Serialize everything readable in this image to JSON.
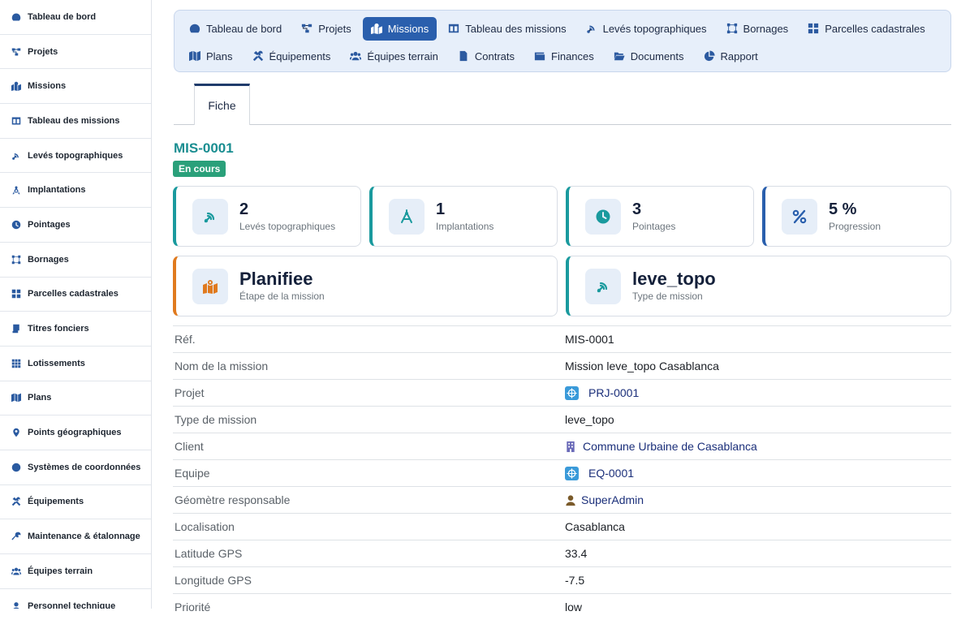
{
  "sidebar": {
    "items": [
      {
        "label": "Tableau de bord",
        "icon": "dashboard-icon"
      },
      {
        "label": "Projets",
        "icon": "project-diagram-icon"
      },
      {
        "label": "Missions",
        "icon": "map-marked-icon"
      },
      {
        "label": "Tableau des missions",
        "icon": "columns-icon"
      },
      {
        "label": "Levés topographiques",
        "icon": "satellite-dish-icon"
      },
      {
        "label": "Implantations",
        "icon": "compass-drafting-icon"
      },
      {
        "label": "Pointages",
        "icon": "clock-icon"
      },
      {
        "label": "Bornages",
        "icon": "vector-square-icon"
      },
      {
        "label": "Parcelles cadastrales",
        "icon": "grid-icon"
      },
      {
        "label": "Titres fonciers",
        "icon": "scroll-icon"
      },
      {
        "label": "Lotissements",
        "icon": "th-icon"
      },
      {
        "label": "Plans",
        "icon": "map-icon"
      },
      {
        "label": "Points géographiques",
        "icon": "map-pin-icon"
      },
      {
        "label": "Systèmes de coordonnées",
        "icon": "globe-icon"
      },
      {
        "label": "Équipements",
        "icon": "tools-icon"
      },
      {
        "label": "Maintenance & étalonnage",
        "icon": "wrench-icon"
      },
      {
        "label": "Équipes terrain",
        "icon": "users-icon"
      },
      {
        "label": "Personnel technique",
        "icon": "user-icon"
      }
    ]
  },
  "topnav": {
    "row1": [
      {
        "label": "Tableau de bord",
        "icon": "dashboard-icon",
        "active": false
      },
      {
        "label": "Projets",
        "icon": "project-diagram-icon",
        "active": false
      },
      {
        "label": "Missions",
        "icon": "map-marked-icon",
        "active": true
      },
      {
        "label": "Tableau des missions",
        "icon": "columns-icon",
        "active": false
      },
      {
        "label": "Levés topographiques",
        "icon": "satellite-dish-icon",
        "active": false
      },
      {
        "label": "Bornages",
        "icon": "vector-square-icon",
        "active": false
      },
      {
        "label": "Parcelles cadastrales",
        "icon": "grid-icon",
        "active": false
      }
    ],
    "row2": [
      {
        "label": "Plans",
        "icon": "map-icon",
        "active": false
      },
      {
        "label": "Équipements",
        "icon": "tools-icon",
        "active": false
      },
      {
        "label": "Équipes terrain",
        "icon": "users-icon",
        "active": false
      },
      {
        "label": "Contrats",
        "icon": "file-contract-icon",
        "active": false
      },
      {
        "label": "Finances",
        "icon": "wallet-icon",
        "active": false
      },
      {
        "label": "Documents",
        "icon": "folder-open-icon",
        "active": false
      },
      {
        "label": "Rapport",
        "icon": "chart-pie-icon",
        "active": false
      }
    ]
  },
  "tabs": {
    "fiche": "Fiche"
  },
  "record": {
    "ref": "MIS-0001",
    "status": "En cours"
  },
  "colors": {
    "accent": "#2a5fad",
    "teal": "#1a9a9e",
    "orange": "#e07a1e",
    "blue": "#2a5fad",
    "status": "#2aa07a"
  },
  "cards": {
    "leves": {
      "value": "2",
      "caption": "Levés topographiques",
      "icon": "satellite-dish-icon"
    },
    "implantations": {
      "value": "1",
      "caption": "Implantations",
      "icon": "compass-drafting-icon"
    },
    "pointages": {
      "value": "3",
      "caption": "Pointages",
      "icon": "clock-icon"
    },
    "progression": {
      "value": "5 %",
      "caption": "Progression",
      "icon": "percent-icon"
    },
    "etape": {
      "value": "Planifiee",
      "caption": "Étape de la mission",
      "icon": "map-marked-icon"
    },
    "type": {
      "value": "leve_topo",
      "caption": "Type de mission",
      "icon": "satellite-dish-icon"
    }
  },
  "details": {
    "ref": {
      "label": "Réf.",
      "value": "MIS-0001"
    },
    "nom": {
      "label": "Nom de la mission",
      "value": "Mission leve_topo Casablanca"
    },
    "projet": {
      "label": "Projet",
      "value": "PRJ-0001"
    },
    "type": {
      "label": "Type de mission",
      "value": "leve_topo"
    },
    "client": {
      "label": "Client",
      "value": "Commune Urbaine de Casablanca"
    },
    "equipe": {
      "label": "Equipe",
      "value": "EQ-0001"
    },
    "geometre": {
      "label": "Géomètre responsable",
      "value": "SuperAdmin"
    },
    "localisation": {
      "label": "Localisation",
      "value": "Casablanca"
    },
    "latitude": {
      "label": "Latitude GPS",
      "value": "33.4"
    },
    "longitude": {
      "label": "Longitude GPS",
      "value": "-7.5"
    },
    "priorite": {
      "label": "Priorité",
      "value": "low"
    }
  }
}
